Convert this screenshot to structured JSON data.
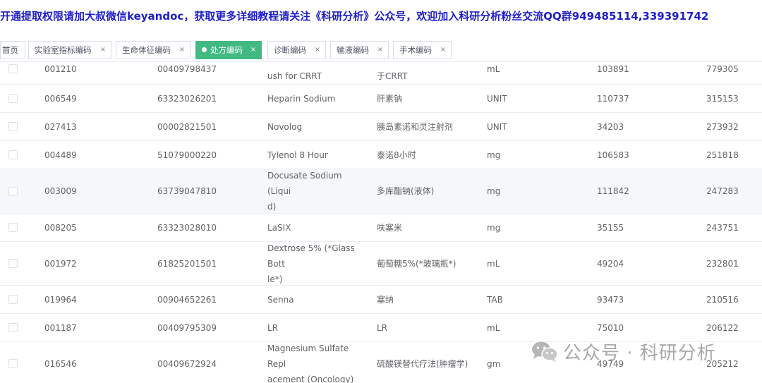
{
  "banner": {
    "text": "开通提取权限请加大叔微信keyandoc，获取更多详细教程请关注《科研分析》公众号，欢迎加入科研分析粉丝交流QQ群949485114,339391742",
    "color": "#1e1ec8"
  },
  "tabs": [
    {
      "label": "首页",
      "closable": false,
      "active": false
    },
    {
      "label": "实验室指标编码",
      "closable": true,
      "active": false
    },
    {
      "label": "生命体征编码",
      "closable": true,
      "active": false
    },
    {
      "label": "处方编码",
      "closable": true,
      "active": true
    },
    {
      "label": "诊断编码",
      "closable": true,
      "active": false
    },
    {
      "label": "输液编码",
      "closable": true,
      "active": false
    },
    {
      "label": "手术编码",
      "closable": true,
      "active": false
    }
  ],
  "tab_close_glyph": "×",
  "accent_color": "#42b983",
  "rows": [
    {
      "id": "001210",
      "ndc": "00409798437",
      "name": [
        "ush for CRRT"
      ],
      "name_cn": [
        "于CRRT"
      ],
      "unit": "mL",
      "count1": "103891",
      "count2": "779305",
      "partial": true
    },
    {
      "id": "006549",
      "ndc": "63323026201",
      "name": [
        "Heparin Sodium"
      ],
      "name_cn": [
        "肝素钠"
      ],
      "unit": "UNIT",
      "count1": "110737",
      "count2": "315153"
    },
    {
      "id": "027413",
      "ndc": "00002821501",
      "name": [
        "Novolog"
      ],
      "name_cn": [
        "胰岛素诺和灵注射剂"
      ],
      "unit": "UNIT",
      "count1": "34203",
      "count2": "273932"
    },
    {
      "id": "004489",
      "ndc": "51079000220",
      "name": [
        "Tylenol 8 Hour"
      ],
      "name_cn": [
        "泰诺8小时"
      ],
      "unit": "mg",
      "count1": "106583",
      "count2": "251818"
    },
    {
      "id": "003009",
      "ndc": "63739047810",
      "name": [
        "Docusate Sodium (Liqui",
        "d)"
      ],
      "name_cn": [
        "多库酯钠(液体)"
      ],
      "unit": "mg",
      "count1": "111842",
      "count2": "247283",
      "hover": true
    },
    {
      "id": "008205",
      "ndc": "63323028010",
      "name": [
        "LaSIX"
      ],
      "name_cn": [
        "呋塞米"
      ],
      "unit": "mg",
      "count1": "35155",
      "count2": "243751"
    },
    {
      "id": "001972",
      "ndc": "61825201501",
      "name": [
        "Dextrose 5% (*Glass Bott",
        "le*)"
      ],
      "name_cn": [
        "葡萄糖5%(*玻璃瓶*)"
      ],
      "unit": "mL",
      "count1": "49204",
      "count2": "232801"
    },
    {
      "id": "019964",
      "ndc": "00904652261",
      "name": [
        "Senna"
      ],
      "name_cn": [
        "塞纳"
      ],
      "unit": "TAB",
      "count1": "93473",
      "count2": "210516"
    },
    {
      "id": "001187",
      "ndc": "00409795309",
      "name": [
        "LR"
      ],
      "name_cn": [
        "LR"
      ],
      "unit": "mL",
      "count1": "75010",
      "count2": "206122"
    },
    {
      "id": "016546",
      "ndc": "00409672924",
      "name": [
        "Magnesium Sulfate Repl",
        "acement (Oncology)"
      ],
      "name_cn": [
        "硫酸镁替代疗法(肿瘤学)"
      ],
      "unit": "gm",
      "count1": "49749",
      "count2": "205212"
    }
  ],
  "watermark": {
    "text": "公众号 · 科研分析",
    "icon": "wechat-icon"
  }
}
